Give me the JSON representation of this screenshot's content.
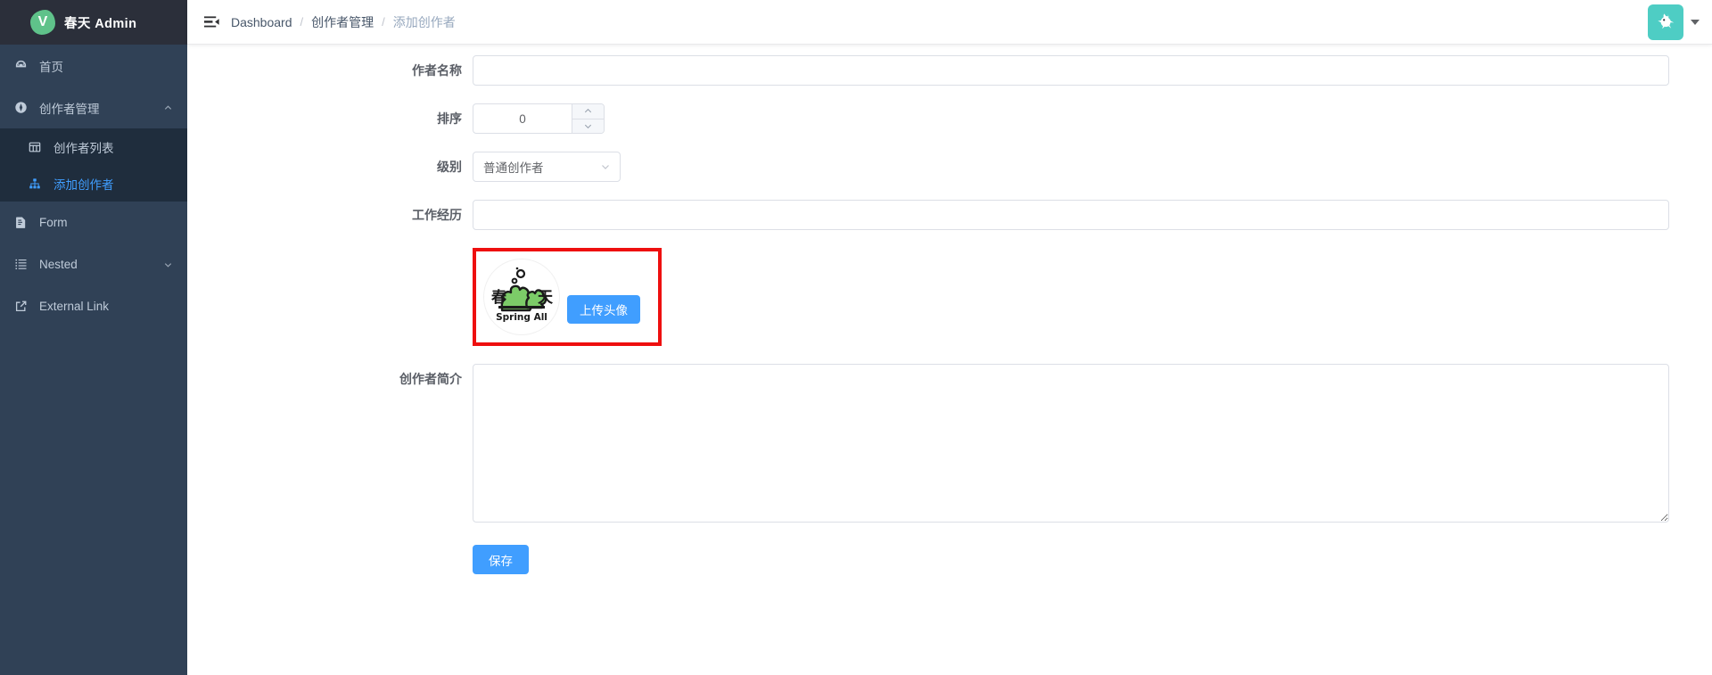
{
  "sidebar": {
    "brand": {
      "text": "春天 Admin",
      "mark": "V",
      "mark_color": "#5fc28a"
    },
    "items": [
      {
        "label": "首页",
        "icon": "dashboard-icon"
      },
      {
        "label": "创作者管理",
        "icon": "compass-icon",
        "arrow": "chevron-up-icon"
      },
      {
        "label": "创作者列表",
        "icon": "grid-icon"
      },
      {
        "label": "添加创作者",
        "icon": "sitemap-icon"
      },
      {
        "label": "Form",
        "icon": "form-icon"
      },
      {
        "label": "Nested",
        "icon": "list-icon",
        "arrow": "chevron-down-icon"
      },
      {
        "label": "External Link",
        "icon": "external-link-icon"
      }
    ],
    "active_color": "#409EFF",
    "bg_color": "#304156",
    "submenu_bg_color": "#1F2D3D"
  },
  "navbar": {
    "hamburger": "hamburger-icon",
    "breadcrumb": [
      {
        "label": "Dashboard",
        "type": "link"
      },
      {
        "label": "创作者管理",
        "type": "link"
      },
      {
        "label": "添加创作者",
        "type": "current"
      }
    ],
    "separator": "/",
    "avatar": {
      "name": "avatar",
      "bg_color": "#4ECDC4"
    },
    "caret": "caret-down-icon"
  },
  "form": {
    "fields": {
      "author_name": {
        "label": "作者名称",
        "value": "",
        "placeholder": ""
      },
      "sort": {
        "label": "排序",
        "value": "0"
      },
      "level": {
        "label": "级别",
        "value": "普通创作者"
      },
      "work_experience": {
        "label": "工作经历",
        "value": "",
        "placeholder": ""
      },
      "intro": {
        "label": "创作者简介",
        "value": "",
        "placeholder": ""
      }
    },
    "avatar_upload": {
      "button_label": "上传头像",
      "highlight_color": "#EE0F0F",
      "logo_text": "Spring All",
      "logo_left_char": "春",
      "logo_right_char": "天"
    },
    "save_label": "保存",
    "primary_color": "#409EFF"
  }
}
